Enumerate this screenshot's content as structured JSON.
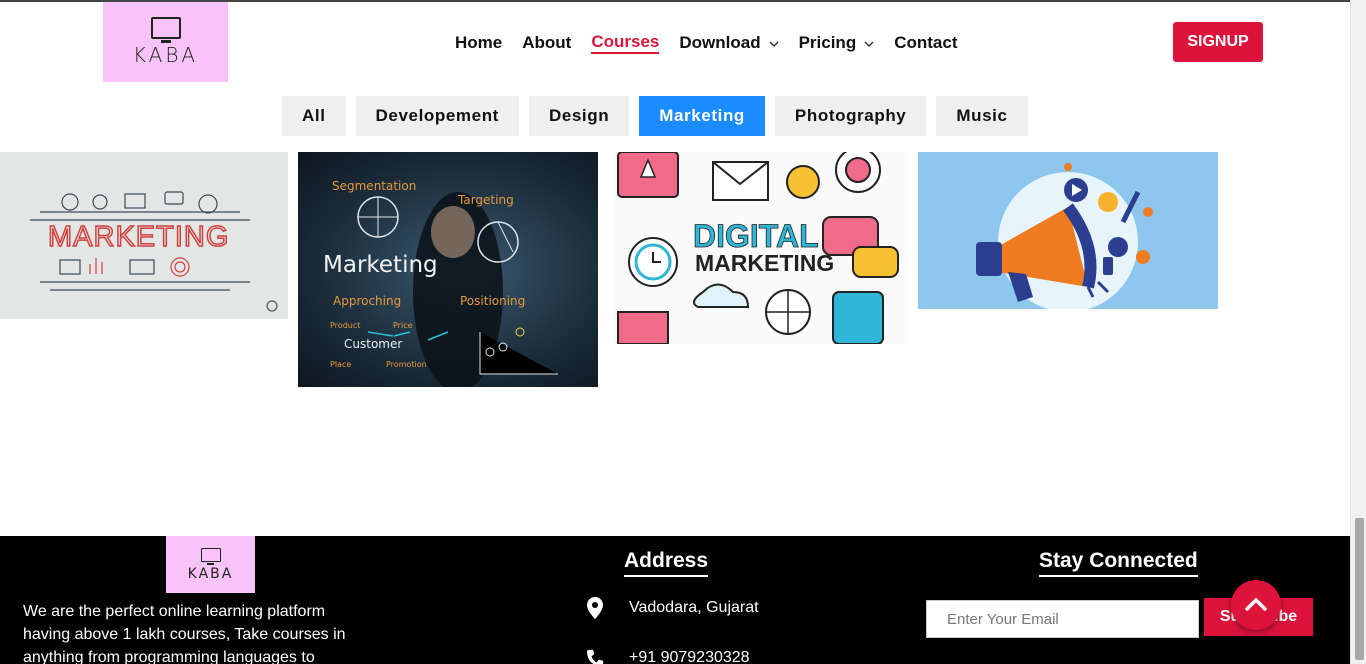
{
  "header": {
    "logo_text": "KABA",
    "nav": [
      {
        "label": "Home"
      },
      {
        "label": "About"
      },
      {
        "label": "Courses"
      },
      {
        "label": "Download"
      },
      {
        "label": "Pricing"
      },
      {
        "label": "Contact"
      }
    ],
    "signup_label": "SIGNUP"
  },
  "filters": [
    "All",
    "Developement",
    "Design",
    "Marketing",
    "Photography",
    "Music"
  ],
  "gallery": {
    "card1_text": "MARKETING",
    "card2_words": [
      "Segmentation",
      "Targeting",
      "Marketing",
      "Approching",
      "Positioning",
      "Product",
      "Price",
      "Customer",
      "Place",
      "Promotion"
    ],
    "card3_line1": "DIGITAL",
    "card3_line2": "MARKETING"
  },
  "footer": {
    "logo_text": "KABA",
    "description": "We are the perfect online learning platform having above 1 lakh courses, Take courses in anything from programming languages to",
    "address_title": "Address",
    "location": "Vadodara, Gujarat",
    "phone": "+91 9079230328",
    "stay_title": "Stay Connected",
    "email_placeholder": "Enter Your Email",
    "subscribe_label": "Subscribe"
  },
  "colors": {
    "brand_red": "#dc143c",
    "active_filter": "#1a8cff",
    "logo_bg": "#f8c3f8"
  },
  "icons": [
    "monitor-chart-icon",
    "chevron-down-icon",
    "map-pin-icon",
    "phone-icon",
    "chevron-up-icon"
  ]
}
